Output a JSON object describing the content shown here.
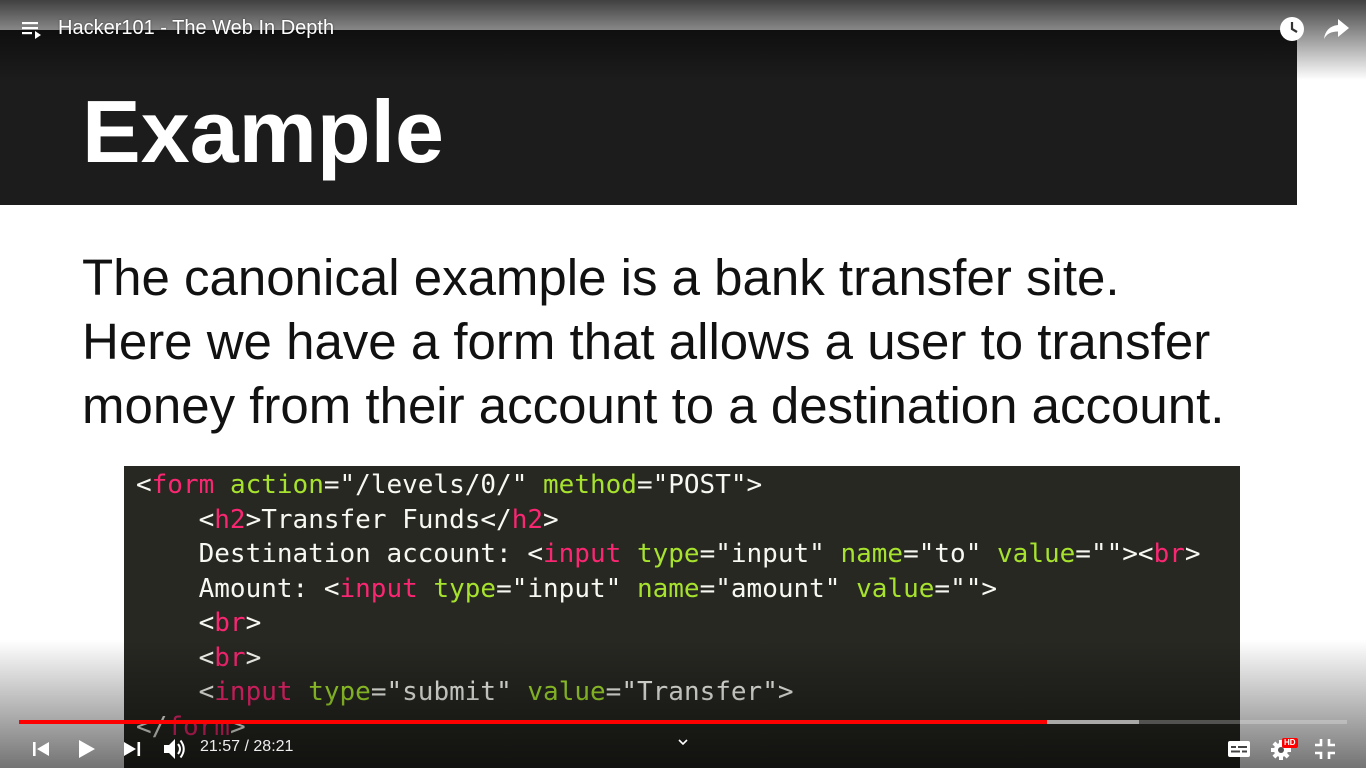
{
  "player": {
    "title": "Hacker101 - The Web In Depth",
    "time_current": "21:57",
    "time_separator": " / ",
    "time_total": "28:21",
    "progress_played_fraction": 0.774,
    "progress_buffered_fraction": 0.843,
    "hd_badge": "HD",
    "accent_color": "#ff0000"
  },
  "icons": {
    "playlist": "playlist-icon",
    "watch_later": "clock-icon",
    "share": "share-arrow-icon",
    "previous": "skip-previous-icon",
    "play": "play-icon",
    "next": "skip-next-icon",
    "volume": "volume-icon",
    "chevron": "chevron-down-icon",
    "subtitles": "subtitles-icon",
    "settings": "gear-icon",
    "exit_fullscreen": "exit-fullscreen-icon"
  },
  "slide": {
    "title": "Example",
    "body_lines": [
      "The canonical example is a bank transfer site.",
      "Here we have a form that allows a user to transfer",
      "money from their account to a destination account."
    ],
    "code_lines": [
      [
        [
          "p",
          "<"
        ],
        [
          "t",
          "form"
        ],
        [
          "p",
          " "
        ],
        [
          "a",
          "action"
        ],
        [
          "p",
          "="
        ],
        [
          "s",
          "\"/levels/0/\""
        ],
        [
          "p",
          " "
        ],
        [
          "a",
          "method"
        ],
        [
          "p",
          "="
        ],
        [
          "s",
          "\"POST\""
        ],
        [
          "p",
          ">"
        ]
      ],
      [
        [
          "p",
          "    <"
        ],
        [
          "t",
          "h2"
        ],
        [
          "p",
          ">Transfer Funds</"
        ],
        [
          "t",
          "h2"
        ],
        [
          "p",
          ">"
        ]
      ],
      [
        [
          "p",
          "    Destination account: <"
        ],
        [
          "t",
          "input"
        ],
        [
          "p",
          " "
        ],
        [
          "a",
          "type"
        ],
        [
          "p",
          "="
        ],
        [
          "s",
          "\"input\""
        ],
        [
          "p",
          " "
        ],
        [
          "a",
          "name"
        ],
        [
          "p",
          "="
        ],
        [
          "s",
          "\"to\""
        ],
        [
          "p",
          " "
        ],
        [
          "a",
          "value"
        ],
        [
          "p",
          "="
        ],
        [
          "s",
          "\"\""
        ],
        [
          "p",
          "><"
        ],
        [
          "t",
          "br"
        ],
        [
          "p",
          ">"
        ]
      ],
      [
        [
          "p",
          "    Amount: <"
        ],
        [
          "t",
          "input"
        ],
        [
          "p",
          " "
        ],
        [
          "a",
          "type"
        ],
        [
          "p",
          "="
        ],
        [
          "s",
          "\"input\""
        ],
        [
          "p",
          " "
        ],
        [
          "a",
          "name"
        ],
        [
          "p",
          "="
        ],
        [
          "s",
          "\"amount\""
        ],
        [
          "p",
          " "
        ],
        [
          "a",
          "value"
        ],
        [
          "p",
          "="
        ],
        [
          "s",
          "\"\""
        ],
        [
          "p",
          ">"
        ]
      ],
      [
        [
          "p",
          "    <"
        ],
        [
          "t",
          "br"
        ],
        [
          "p",
          ">"
        ]
      ],
      [
        [
          "p",
          "    <"
        ],
        [
          "t",
          "br"
        ],
        [
          "p",
          ">"
        ]
      ],
      [
        [
          "p",
          "    <"
        ],
        [
          "t",
          "input"
        ],
        [
          "p",
          " "
        ],
        [
          "a",
          "type"
        ],
        [
          "p",
          "="
        ],
        [
          "s",
          "\"submit\""
        ],
        [
          "p",
          " "
        ],
        [
          "a",
          "value"
        ],
        [
          "p",
          "="
        ],
        [
          "s",
          "\"Transfer\""
        ],
        [
          "p",
          ">"
        ]
      ],
      [
        [
          "p",
          "</"
        ],
        [
          "t",
          "form"
        ],
        [
          "p",
          ">"
        ]
      ]
    ]
  }
}
